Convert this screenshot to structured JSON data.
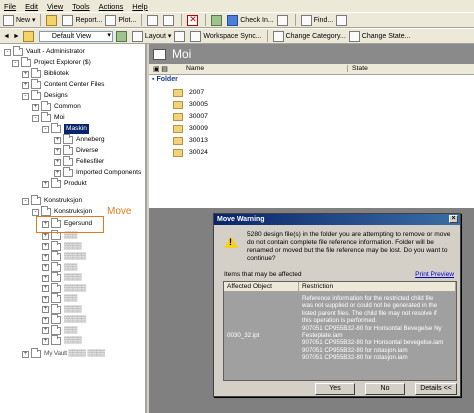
{
  "menu": [
    "File",
    "Edit",
    "View",
    "Tools",
    "Actions",
    "Help"
  ],
  "toolbar1": {
    "new": "New",
    "report": "Report...",
    "plot": "Plot...",
    "check_in": "Check In...",
    "find": "Find..."
  },
  "toolbar2": {
    "view_select": "Default View",
    "layout": "Layout",
    "workspace_sync": "Workspace Sync...",
    "change_category": "Change Category...",
    "change_state": "Change State..."
  },
  "tree": [
    {
      "label": "Vault - Administrator",
      "depth": 0,
      "pm": "-"
    },
    {
      "label": "Project Explorer ($)",
      "depth": 1,
      "pm": "-"
    },
    {
      "label": "Bibliotek",
      "depth": 2,
      "pm": "+"
    },
    {
      "label": "Content Center Files",
      "depth": 2,
      "pm": "+"
    },
    {
      "label": "Designs",
      "depth": 2,
      "pm": "-"
    },
    {
      "label": "Common",
      "depth": 3,
      "pm": "+"
    },
    {
      "label": "Moi",
      "depth": 3,
      "pm": "-"
    },
    {
      "label": "Maskin",
      "depth": 4,
      "pm": "-",
      "selected": true
    },
    {
      "label": "Anneberg",
      "depth": 5,
      "pm": "+"
    },
    {
      "label": "Diverse",
      "depth": 5,
      "pm": "+"
    },
    {
      "label": "Fellesfiler",
      "depth": 5,
      "pm": "+"
    },
    {
      "label": "Imported Components",
      "depth": 5,
      "pm": "+"
    },
    {
      "label": "Produkt",
      "depth": 4,
      "pm": "+"
    },
    {
      "label": "Konstruksjon",
      "depth": 2,
      "pm": "-"
    },
    {
      "label": "Konstruksjon",
      "depth": 3,
      "pm": "-"
    },
    {
      "label": "Egersund",
      "depth": 4,
      "pm": "+"
    }
  ],
  "tree_blurred_rows": 11,
  "tree_bottom_label": "My Vault",
  "move_label": "Move",
  "right_header": "Moi",
  "list": {
    "columns": [
      "Name",
      "State"
    ],
    "group": "Folder",
    "rows": [
      "2007",
      "30005",
      "30007",
      "30009",
      "30013",
      "30024"
    ]
  },
  "dialog": {
    "title": "Move Warning",
    "message": "5280 design file(s) in the folder you are attempting to remove or move do not contain complete file reference information. Folder will be renamed or moved but the file reference may be lost. Do you want to continue?",
    "items_label": "Items that may be affected",
    "print_preview": "Print Preview",
    "columns": [
      "Affected Object",
      "Restriction"
    ],
    "affected_object": "0030_32.ipt",
    "restriction_lines": [
      "Reference information for the restricted child file",
      "was not supplied or could not be generated in the",
      "listed parent files. The child file may not resolve if",
      "this operation is performed.",
      "907051 CP955B32-80 for Horisontal Bevegelse Ny",
      "Festeplate.iam",
      "907051 CP955B32-80 for Horisontal bevegelse.iam",
      "907051 CP955B32-80 for rotasjon.iam",
      "907051 CP955B32-80 for rotasjon.iam"
    ],
    "buttons": {
      "yes": "Yes",
      "no": "No",
      "details": "Details <<"
    }
  },
  "colors": {
    "selection": "#0a246a",
    "annotation": "#e07a1f",
    "link": "#0000cc"
  }
}
